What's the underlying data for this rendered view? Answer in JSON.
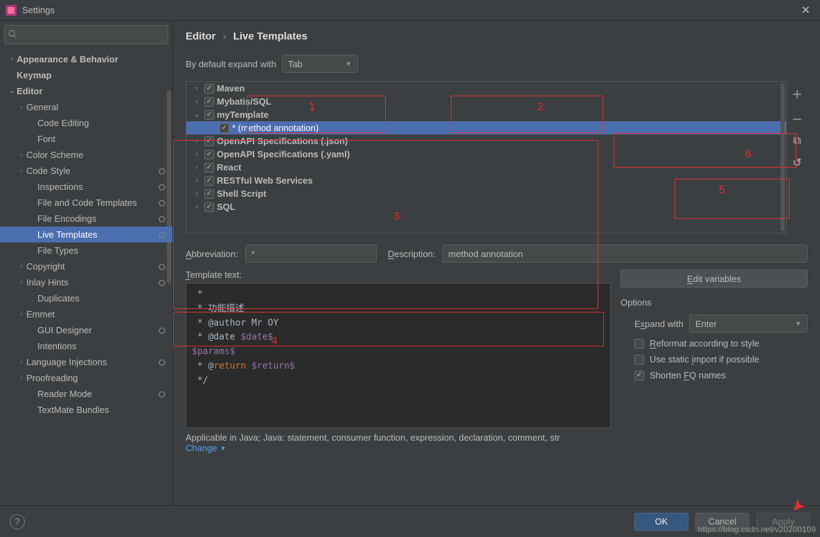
{
  "window": {
    "title": "Settings"
  },
  "search": {
    "placeholder": ""
  },
  "sidebar": {
    "items": [
      {
        "label": "Appearance & Behavior",
        "arrow": "›",
        "bold": true,
        "lvl": 0
      },
      {
        "label": "Keymap",
        "arrow": "",
        "bold": true,
        "lvl": 0
      },
      {
        "label": "Editor",
        "arrow": "⌄",
        "bold": true,
        "lvl": 0
      },
      {
        "label": "General",
        "arrow": "›",
        "lvl": 1
      },
      {
        "label": "Code Editing",
        "arrow": "",
        "lvl": 2
      },
      {
        "label": "Font",
        "arrow": "",
        "lvl": 2
      },
      {
        "label": "Color Scheme",
        "arrow": "›",
        "lvl": 1
      },
      {
        "label": "Code Style",
        "arrow": "›",
        "lvl": 1,
        "gear": true
      },
      {
        "label": "Inspections",
        "arrow": "",
        "lvl": 2,
        "gear": true
      },
      {
        "label": "File and Code Templates",
        "arrow": "",
        "lvl": 2,
        "gear": true
      },
      {
        "label": "File Encodings",
        "arrow": "",
        "lvl": 2,
        "gear": true
      },
      {
        "label": "Live Templates",
        "arrow": "",
        "lvl": 2,
        "sel": true,
        "gear": true
      },
      {
        "label": "File Types",
        "arrow": "",
        "lvl": 2
      },
      {
        "label": "Copyright",
        "arrow": "›",
        "lvl": 1,
        "gear": true
      },
      {
        "label": "Inlay Hints",
        "arrow": "›",
        "lvl": 1,
        "gear": true
      },
      {
        "label": "Duplicates",
        "arrow": "",
        "lvl": 2
      },
      {
        "label": "Emmet",
        "arrow": "›",
        "lvl": 1
      },
      {
        "label": "GUI Designer",
        "arrow": "",
        "lvl": 2,
        "gear": true
      },
      {
        "label": "Intentions",
        "arrow": "",
        "lvl": 2
      },
      {
        "label": "Language Injections",
        "arrow": "›",
        "lvl": 1,
        "gear": true
      },
      {
        "label": "Proofreading",
        "arrow": "›",
        "lvl": 1
      },
      {
        "label": "Reader Mode",
        "arrow": "",
        "lvl": 2,
        "gear": true
      },
      {
        "label": "TextMate Bundles",
        "arrow": "",
        "lvl": 2
      }
    ]
  },
  "breadcrumb": {
    "a": "Editor",
    "sep": "›",
    "b": "Live Templates"
  },
  "expand_default": {
    "label": "By default expand with",
    "value": "Tab"
  },
  "template_list": [
    {
      "label": "Maven",
      "arrow": "›",
      "checked": true,
      "indent": 0
    },
    {
      "label": "Mybatis/SQL",
      "arrow": "›",
      "checked": true,
      "indent": 0
    },
    {
      "label": "myTemplate",
      "arrow": "⌄",
      "checked": true,
      "indent": 0
    },
    {
      "label": "* (method annotation)",
      "arrow": "",
      "checked": true,
      "indent": 1,
      "sel": true,
      "dim": true
    },
    {
      "label": "OpenAPI Specifications (.json)",
      "arrow": "›",
      "checked": true,
      "indent": 0
    },
    {
      "label": "OpenAPI Specifications (.yaml)",
      "arrow": "›",
      "checked": true,
      "indent": 0
    },
    {
      "label": "React",
      "arrow": "›",
      "checked": true,
      "indent": 0
    },
    {
      "label": "RESTful Web Services",
      "arrow": "›",
      "checked": true,
      "indent": 0
    },
    {
      "label": "Shell Script",
      "arrow": "›",
      "checked": true,
      "indent": 0
    },
    {
      "label": "SQL",
      "arrow": "›",
      "checked": true,
      "indent": 0
    }
  ],
  "side_btns": {
    "add": "＋",
    "remove": "－",
    "copy": "⧉",
    "revert": "↺"
  },
  "fields": {
    "abbr_label": "Abbreviation:",
    "abbr_value": "*",
    "desc_label": "Description:",
    "desc_value": "method annotation",
    "tt_label": "Template text:",
    "edit_vars": "Edit variables"
  },
  "code": {
    "l1": " *",
    "l2": " * 功能描述",
    "l3": " * @author Mr OY",
    "l4": " * @date $date$",
    "l5": "$params$",
    "l6a": " * @",
    "l6kw": "return",
    "l6b": " $return$",
    "l7": " */"
  },
  "options": {
    "title": "Options",
    "expand_label": "Expand with",
    "expand_value": "Enter",
    "reformat": "Reformat according to style",
    "static": "Use static import if possible",
    "shorten": "Shorten FQ names"
  },
  "applicable": {
    "text": "Applicable in Java; Java: statement, consumer function, expression, declaration, comment, str",
    "change": "Change"
  },
  "footer": {
    "help": "?",
    "ok": "OK",
    "cancel": "Cancel",
    "apply": "Apply"
  },
  "annotations": {
    "n1": "1",
    "n2": "2",
    "n3": "3",
    "n4": "4",
    "n5": "5",
    "n6": "6"
  },
  "watermark": "https://blog.csdn.net/v20200109"
}
